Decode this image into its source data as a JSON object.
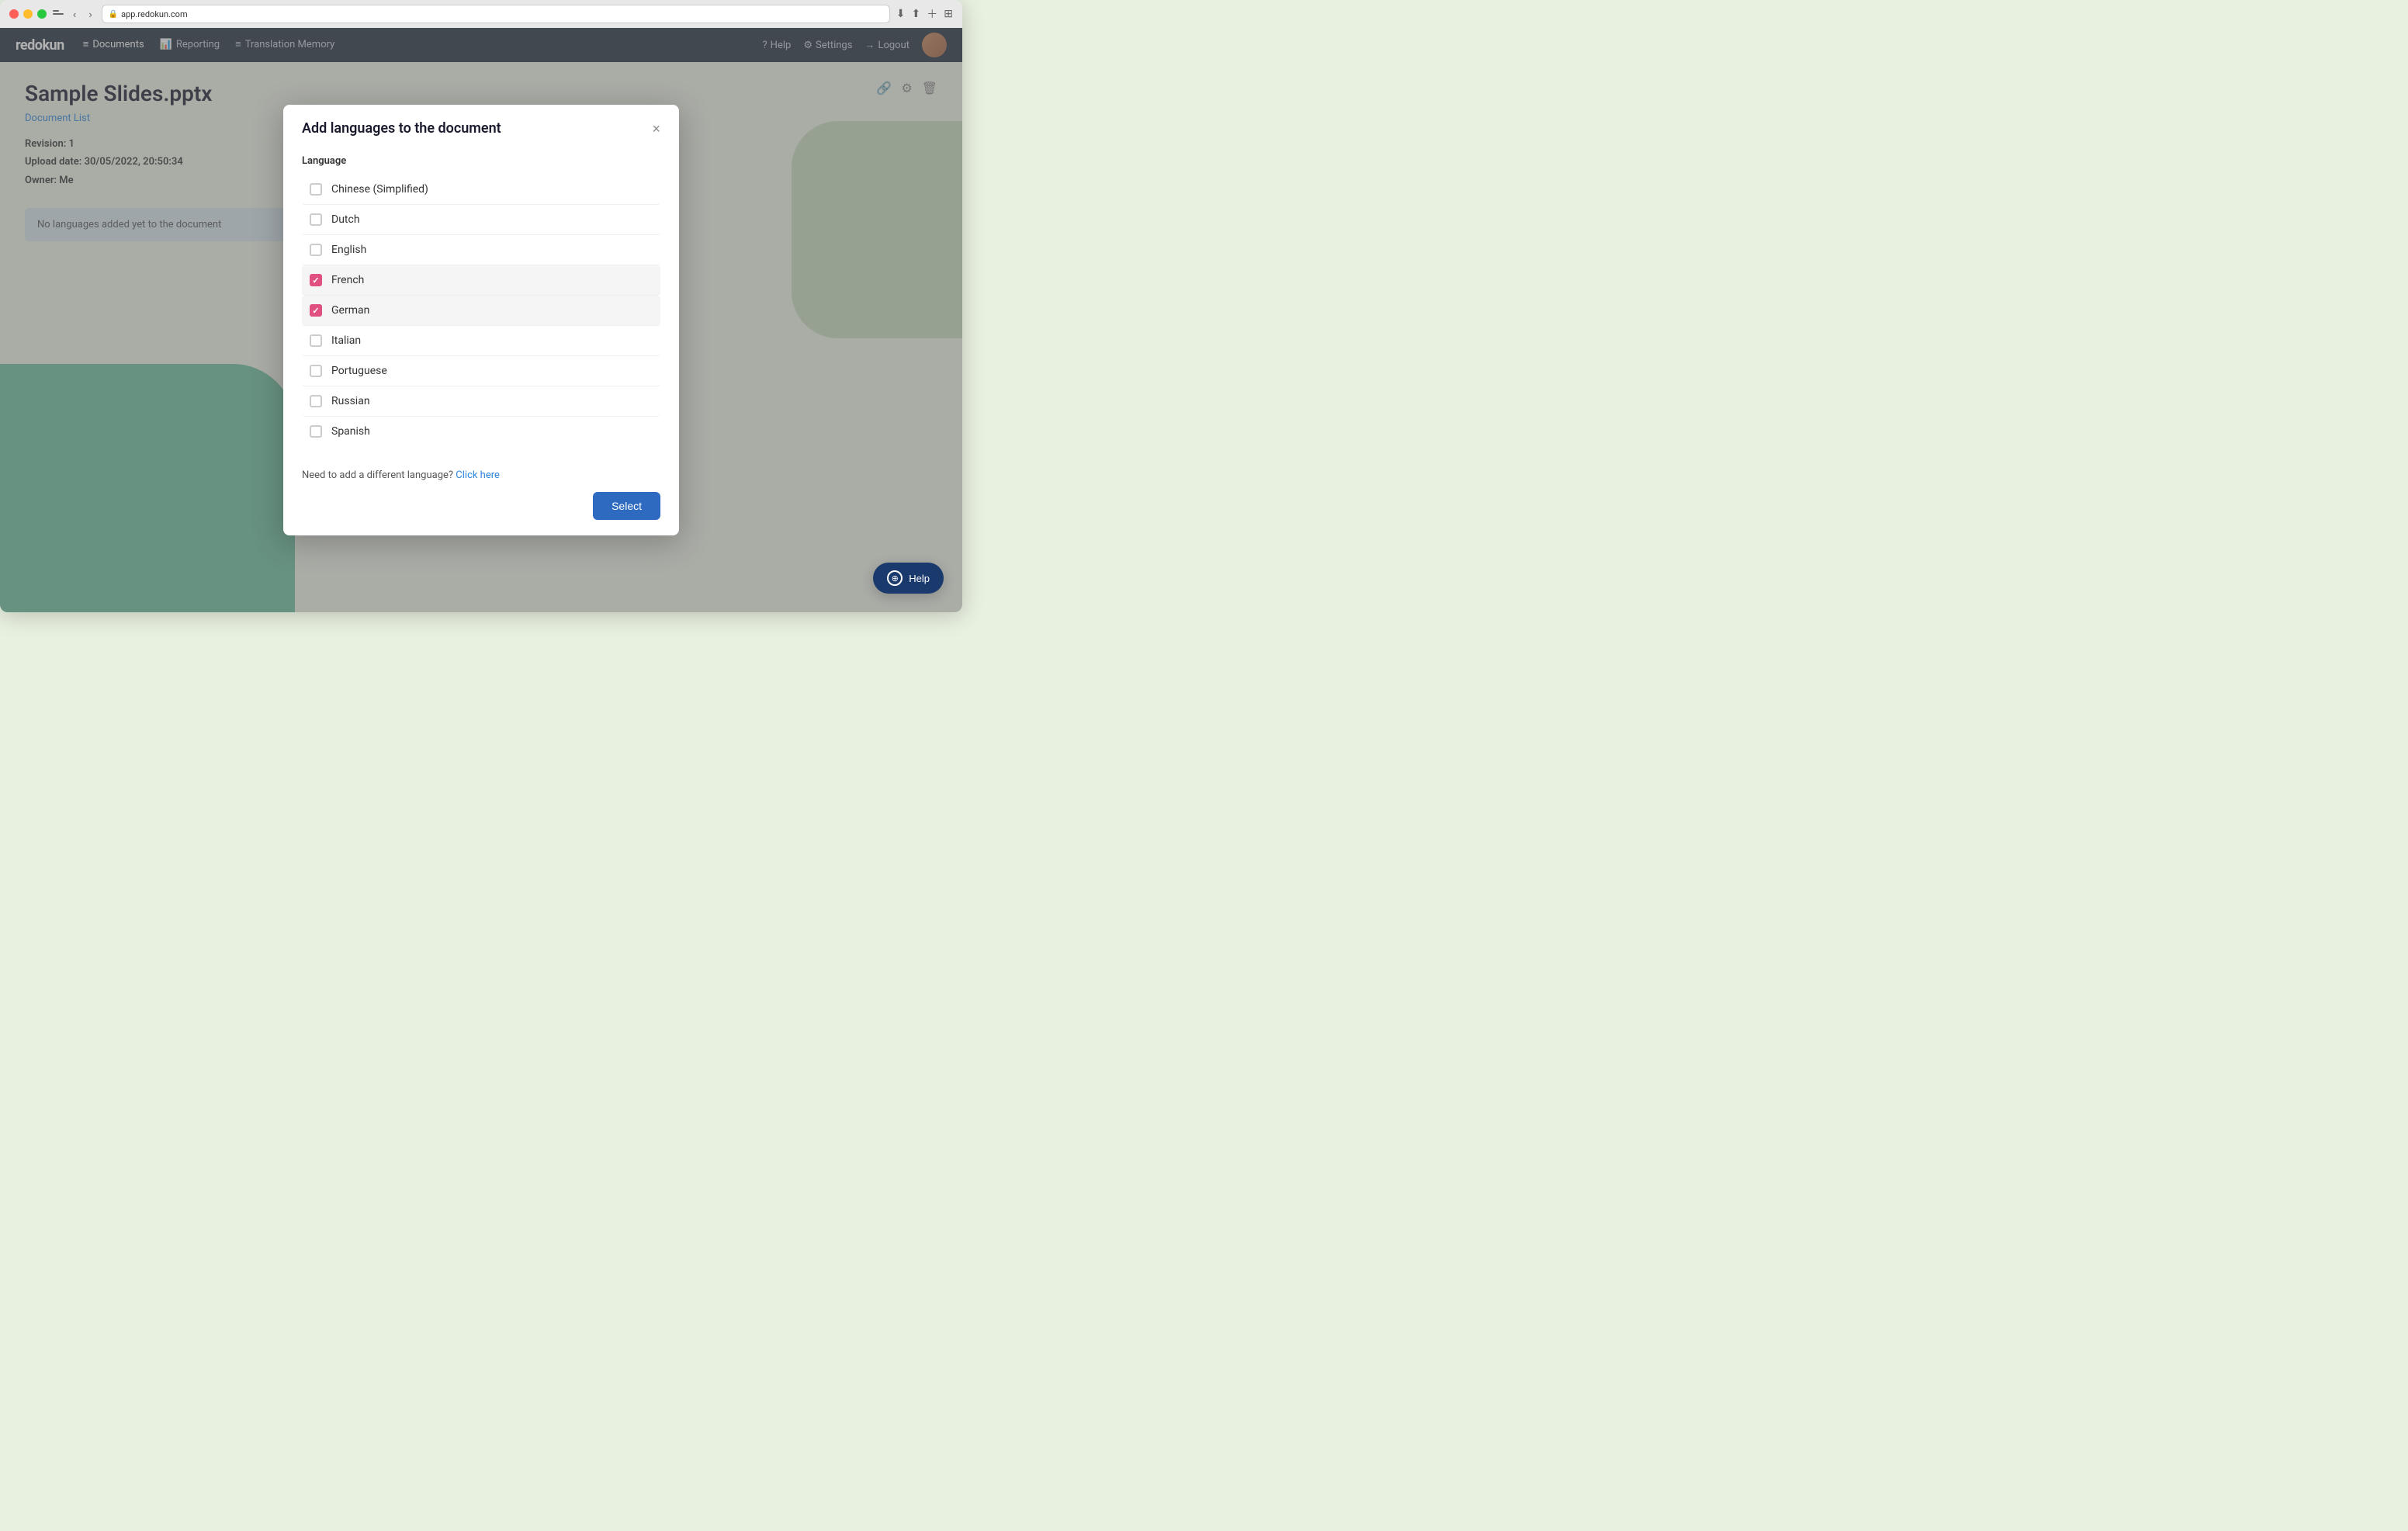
{
  "browser": {
    "url": "app.redokun.com",
    "toolbar_buttons": [
      "←",
      "→"
    ]
  },
  "navbar": {
    "brand": "redokun",
    "nav_items": [
      {
        "label": "Documents",
        "icon": "≡",
        "active": true
      },
      {
        "label": "Reporting",
        "icon": "📊"
      },
      {
        "label": "Translation Memory",
        "icon": "≡"
      }
    ],
    "right_items": [
      {
        "label": "Help",
        "icon": "?"
      },
      {
        "label": "Settings",
        "icon": "⚙"
      },
      {
        "label": "Logout",
        "icon": "→"
      }
    ]
  },
  "page": {
    "title": "Sample Slides.pptx",
    "breadcrumb": "Document List",
    "revision_label": "Revision:",
    "revision_value": "1",
    "upload_date_label": "Upload date:",
    "upload_date_value": "30/05/2022, 20:50:34",
    "owner_label": "Owner:",
    "owner_value": "Me",
    "no_languages_msg": "No languages added yet to the document"
  },
  "modal": {
    "title": "Add languages to the document",
    "close_label": "×",
    "language_header": "Language",
    "languages": [
      {
        "name": "Chinese (Simplified)",
        "checked": false
      },
      {
        "name": "Dutch",
        "checked": false
      },
      {
        "name": "English",
        "checked": false
      },
      {
        "name": "French",
        "checked": true
      },
      {
        "name": "German",
        "checked": true
      },
      {
        "name": "Italian",
        "checked": false
      },
      {
        "name": "Portuguese",
        "checked": false
      },
      {
        "name": "Russian",
        "checked": false
      },
      {
        "name": "Spanish",
        "checked": false
      }
    ],
    "different_language_text": "Need to add a different language?",
    "click_here_label": "Click here",
    "select_button_label": "Select"
  },
  "help_fab": {
    "label": "Help"
  }
}
